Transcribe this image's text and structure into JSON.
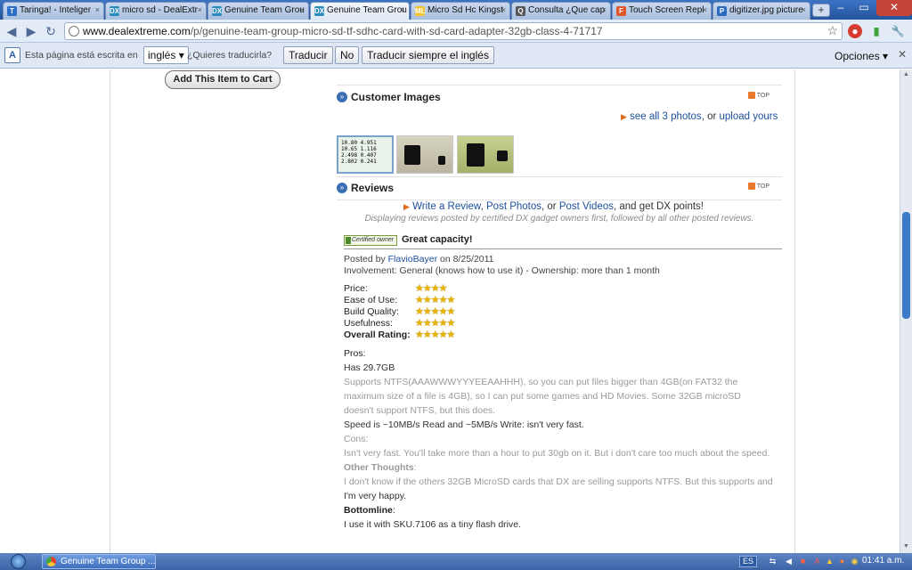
{
  "browser": {
    "tabs": [
      {
        "title": "Taringa! - Inteliger",
        "icon": "T",
        "color": "#2b6fc7"
      },
      {
        "title": "micro sd - DealExtr",
        "icon": "DX",
        "color": "#2a8bbf"
      },
      {
        "title": "Genuine Team Grou",
        "icon": "DX",
        "color": "#2a8bbf"
      },
      {
        "title": "Genuine Team Grou",
        "icon": "DX",
        "color": "#2a8bbf"
      },
      {
        "title": "Micro Sd Hc Kingst",
        "icon": "ML",
        "color": "#f1c232"
      },
      {
        "title": "Consulta ¿Que cap",
        "icon": "Q",
        "color": "#555555"
      },
      {
        "title": "Touch Screen Repl",
        "icon": "F",
        "color": "#e2552b"
      },
      {
        "title": "digitizer.jpg picture",
        "icon": "P",
        "color": "#2e6cc0"
      }
    ],
    "active_tab": 3,
    "url_host": "www.dealextreme.com",
    "url_path": "/p/genuine-team-group-micro-sd-tf-sdhc-card-with-sd-card-adapter-32gb-class-4-71717"
  },
  "translate_bar": {
    "prefix": "Esta página está escrita en",
    "language": "inglés",
    "question": "¿Quieres traducirla?",
    "translate_btn": "Traducir",
    "no_btn": "No",
    "always_btn": "Traducir siempre el inglés",
    "options": "Opciones"
  },
  "page": {
    "add_to_cart": "Add This Item to Cart",
    "customer_images": {
      "title": "Customer Images",
      "top": "TOP",
      "see_all": "see all 3 photos",
      "or": ", or ",
      "upload": "upload yours",
      "screenshot_lines": [
        "10.80 4.951",
        "10.65 1.116",
        "2.498 0.407",
        "2.802 0.241"
      ]
    },
    "reviews": {
      "title": "Reviews",
      "top": "TOP",
      "write": "Write a Review",
      "post_photos": "Post Photos",
      "post_videos": "Post Videos",
      "cta_tail": ", and get DX points!",
      "comma": ", ",
      "or": ", or ",
      "note": "Displaying reviews posted by certified DX gadget owners first, followed by all other posted reviews."
    },
    "review": {
      "badge": "Certified owner",
      "title": "Great capacity!",
      "posted_by": "Posted by ",
      "author": "FlavioBayer",
      "posted_on": " on 8/25/2011",
      "involvement": "Involvement: General (knows how to use it) - Ownership: more than 1 month",
      "ratings": [
        {
          "label": "Price:",
          "stars": 4
        },
        {
          "label": "Ease of Use:",
          "stars": 5
        },
        {
          "label": "Build Quality:",
          "stars": 5
        },
        {
          "label": "Usefulness:",
          "stars": 5
        },
        {
          "label": "Overall Rating:",
          "stars": 5
        }
      ],
      "pros_h": "Pros",
      "pros_1": "Has 29.7GB",
      "pros_2": "Supports NTFS(AAAWWWYYYEEAAHHH), so you can put files bigger than 4GB(on FAT32 the",
      "pros_3": "maximum size of a file is 4GB), so I can put some games and HD Movies. Some 32GB microSD",
      "pros_4": "doesn't support NTFS, but this does.",
      "pros_5": "Speed is ~10MB/s Read and ~5MB/s Write: isn't very fast.",
      "cons_h": "Cons",
      "cons_1": "Isn't very fast. You'll take more than a hour to put 30gb on it. But i don't care too much about the speed.",
      "other_h": "Other Thoughts",
      "other_1": "I don't know if the others 32GB MicroSD cards that DX are selling supports NTFS. But this supports and",
      "other_2": "I'm very happy.",
      "bottom_h": "Bottomline",
      "bottom_1": "I use it with SKU.7106 as a tiny flash drive."
    }
  },
  "taskbar": {
    "task": "Genuine Team Group ...",
    "lang": "ES",
    "clock": "01:41 a.m."
  }
}
